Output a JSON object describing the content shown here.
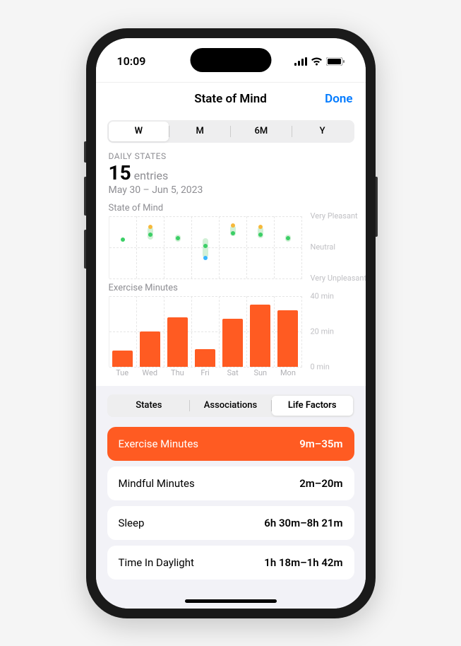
{
  "status": {
    "time": "10:09"
  },
  "nav": {
    "title": "State of Mind",
    "done": "Done"
  },
  "period_tabs": {
    "items": [
      "W",
      "M",
      "6M",
      "Y"
    ],
    "selected": 0
  },
  "summary": {
    "label": "DAILY STATES",
    "count": "15",
    "unit": "entries",
    "range": "May 30 – Jun 5, 2023"
  },
  "chart_data": [
    {
      "type": "scatter",
      "title": "State of Mind",
      "yscale": {
        "labels": [
          "Very Pleasant",
          "Neutral",
          "Very Unpleasant"
        ],
        "positions": [
          0,
          50,
          100
        ]
      },
      "categories": [
        "Tue",
        "Wed",
        "Thu",
        "Fri",
        "Sat",
        "Sun",
        "Mon"
      ],
      "series": [
        {
          "name": "daily",
          "color": "#3bcf66",
          "points": [
            [
              0,
              38
            ],
            [
              1,
              30
            ],
            [
              2,
              36
            ],
            [
              3,
              48
            ],
            [
              4,
              28
            ],
            [
              5,
              30
            ],
            [
              6,
              36
            ]
          ]
        },
        {
          "name": "moment-high",
          "color": "#f6b93b",
          "points": [
            [
              1,
              18
            ],
            [
              4,
              15
            ],
            [
              5,
              18
            ]
          ]
        },
        {
          "name": "moment-low",
          "color": "#37b6ff",
          "points": [
            [
              3,
              68
            ]
          ]
        }
      ],
      "ranges": [
        {
          "x": 1,
          "top": 18,
          "bottom": 38
        },
        {
          "x": 2,
          "top": 30,
          "bottom": 42
        },
        {
          "x": 3,
          "top": 36,
          "bottom": 68
        },
        {
          "x": 4,
          "top": 15,
          "bottom": 32
        },
        {
          "x": 5,
          "top": 18,
          "bottom": 36
        },
        {
          "x": 6,
          "top": 30,
          "bottom": 42
        }
      ]
    },
    {
      "type": "bar",
      "title": "Exercise Minutes",
      "categories": [
        "Tue",
        "Wed",
        "Thu",
        "Fri",
        "Sat",
        "Sun",
        "Mon"
      ],
      "values": [
        9,
        20,
        28,
        10,
        27,
        35,
        32
      ],
      "ylabel": "",
      "xlabel": "",
      "ylim": [
        0,
        40
      ],
      "yticks": [
        0,
        20,
        40
      ],
      "ytick_labels": [
        "0 min",
        "20 min",
        "40 min"
      ],
      "color": "#ff5b22"
    }
  ],
  "bottom_tabs": {
    "items": [
      "States",
      "Associations",
      "Life Factors"
    ],
    "selected": 2
  },
  "factors": [
    {
      "label": "Exercise Minutes",
      "value": "9m–35m",
      "active": true
    },
    {
      "label": "Mindful Minutes",
      "value": "2m–20m",
      "active": false
    },
    {
      "label": "Sleep",
      "value": "6h 30m–8h 21m",
      "active": false
    },
    {
      "label": "Time In Daylight",
      "value": "1h 18m–1h 42m",
      "active": false
    }
  ]
}
